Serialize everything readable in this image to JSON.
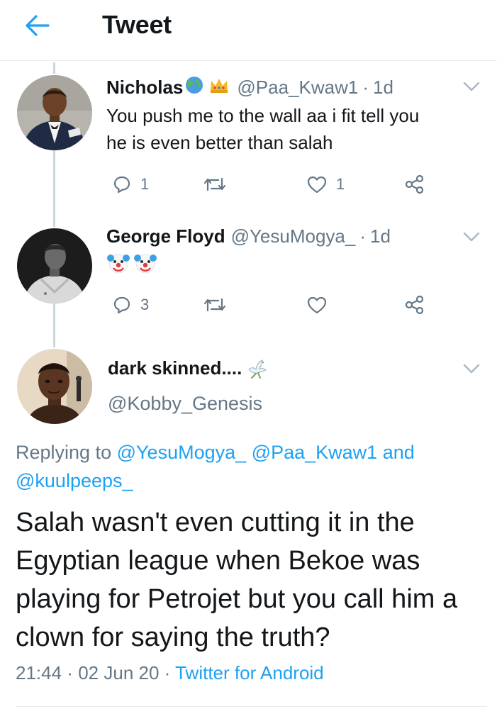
{
  "header": {
    "title": "Tweet",
    "back_icon": "arrow-left-icon",
    "accent": "#1da1f2"
  },
  "colors": {
    "primary_text": "#14171a",
    "secondary_text": "#657786",
    "link": "#1da1f2",
    "thread_line": "#ccd6dd",
    "divider": "#e6ecf0"
  },
  "replies": [
    {
      "display_name": "Nicholas",
      "name_emojis": [
        "globe-emoji",
        "crown-emoji"
      ],
      "handle": "@Paa_Kwaw1",
      "separator": "·",
      "time": "1d",
      "text_lines": [
        "You push me to the wall aa i fit tell you",
        "he is even better than salah"
      ],
      "reply_count": "1",
      "retweet_count": "",
      "like_count": "1"
    },
    {
      "display_name": "George Floyd",
      "handle": "@YesuMogya_",
      "separator": "·",
      "time": "1d",
      "text_emojis": [
        "clown-face-emoji",
        "clown-face-emoji"
      ],
      "reply_count": "3",
      "retweet_count": "",
      "like_count": ""
    }
  ],
  "main_tweet": {
    "display_name": "dark skinned....",
    "name_emoji": "dove-emoji",
    "handle": "@Kobby_Genesis",
    "replying_prefix": "Replying to",
    "replying_mentions": [
      "@YesuMogya_",
      "@Paa_Kwaw1",
      "@kuulpeeps_"
    ],
    "replying_and": "and",
    "text": "Salah wasn't even cutting it in the Egyptian league when Bekoe was playing for Petrojet but you call him a clown for saying the truth?",
    "time": "21:44",
    "date": "02 Jun 20",
    "separator": "·",
    "source": "Twitter for Android"
  }
}
